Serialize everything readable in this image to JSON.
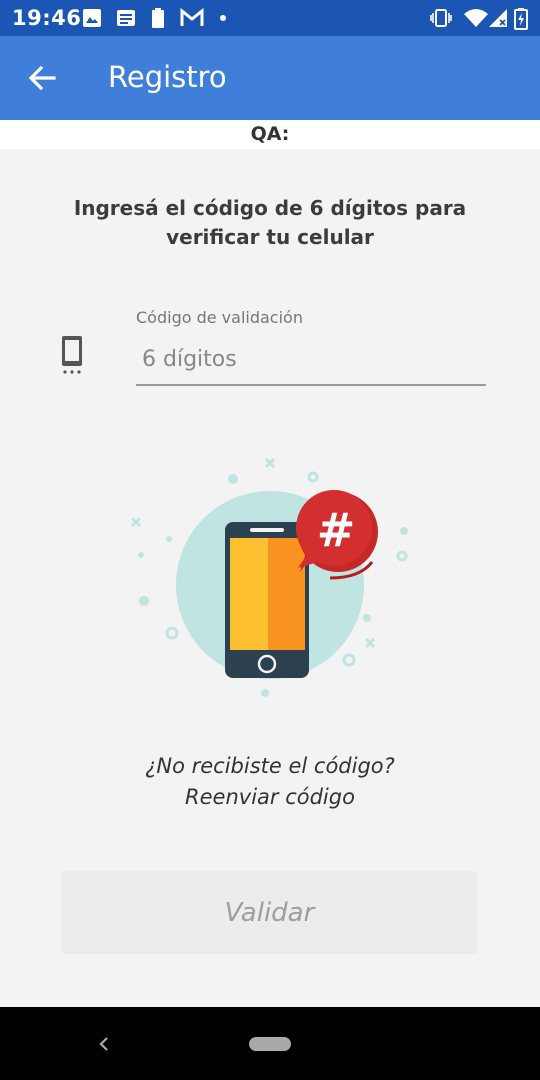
{
  "status_bar": {
    "time": "19:46",
    "left_icons": [
      "image-icon",
      "news-icon",
      "battery-saver-icon",
      "gmail-icon",
      "dot-icon"
    ],
    "right_icons": [
      "vibrate-icon",
      "wifi-icon",
      "signal-icon",
      "battery-charging-icon"
    ]
  },
  "app_bar": {
    "title": "Registro",
    "back_icon": "arrow-left-icon"
  },
  "environment_label": "QA:",
  "instruction": {
    "line1": "Ingresá el código de 6 dígitos para",
    "line2": "verificar tu celular"
  },
  "code_field": {
    "label": "Código de validación",
    "placeholder": "6 dígitos",
    "value": "",
    "icon": "smartphone-icon"
  },
  "illustration": {
    "icon": "phone-hashtag-illustration",
    "glyph": "#"
  },
  "resend": {
    "question": "¿No recibiste el código?",
    "link": "Reenviar código"
  },
  "validate_button": {
    "label": "Validar",
    "enabled": false
  },
  "colors": {
    "status_bar": "#1c56b5",
    "app_bar": "#3f7fda",
    "background": "#f3f3f3",
    "bubble_red": "#d32f2f",
    "circle_teal": "#bfe4e2",
    "phone_dark": "#2b4150",
    "screen_yellow": "#fbbf2f",
    "screen_orange": "#f7931e"
  }
}
